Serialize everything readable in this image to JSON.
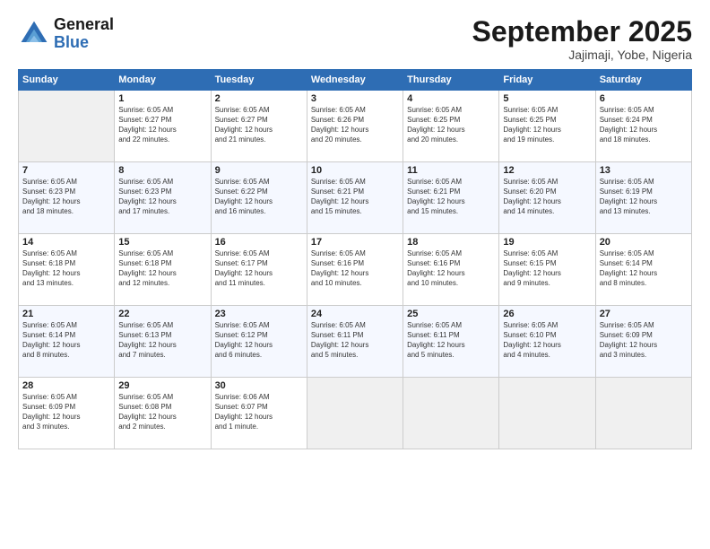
{
  "header": {
    "logo_general": "General",
    "logo_blue": "Blue",
    "month": "September 2025",
    "location": "Jajimaji, Yobe, Nigeria"
  },
  "days_of_week": [
    "Sunday",
    "Monday",
    "Tuesday",
    "Wednesday",
    "Thursday",
    "Friday",
    "Saturday"
  ],
  "weeks": [
    [
      {
        "day": "",
        "info": ""
      },
      {
        "day": "1",
        "info": "Sunrise: 6:05 AM\nSunset: 6:27 PM\nDaylight: 12 hours\nand 22 minutes."
      },
      {
        "day": "2",
        "info": "Sunrise: 6:05 AM\nSunset: 6:27 PM\nDaylight: 12 hours\nand 21 minutes."
      },
      {
        "day": "3",
        "info": "Sunrise: 6:05 AM\nSunset: 6:26 PM\nDaylight: 12 hours\nand 20 minutes."
      },
      {
        "day": "4",
        "info": "Sunrise: 6:05 AM\nSunset: 6:25 PM\nDaylight: 12 hours\nand 20 minutes."
      },
      {
        "day": "5",
        "info": "Sunrise: 6:05 AM\nSunset: 6:25 PM\nDaylight: 12 hours\nand 19 minutes."
      },
      {
        "day": "6",
        "info": "Sunrise: 6:05 AM\nSunset: 6:24 PM\nDaylight: 12 hours\nand 18 minutes."
      }
    ],
    [
      {
        "day": "7",
        "info": "Sunrise: 6:05 AM\nSunset: 6:23 PM\nDaylight: 12 hours\nand 18 minutes."
      },
      {
        "day": "8",
        "info": "Sunrise: 6:05 AM\nSunset: 6:23 PM\nDaylight: 12 hours\nand 17 minutes."
      },
      {
        "day": "9",
        "info": "Sunrise: 6:05 AM\nSunset: 6:22 PM\nDaylight: 12 hours\nand 16 minutes."
      },
      {
        "day": "10",
        "info": "Sunrise: 6:05 AM\nSunset: 6:21 PM\nDaylight: 12 hours\nand 15 minutes."
      },
      {
        "day": "11",
        "info": "Sunrise: 6:05 AM\nSunset: 6:21 PM\nDaylight: 12 hours\nand 15 minutes."
      },
      {
        "day": "12",
        "info": "Sunrise: 6:05 AM\nSunset: 6:20 PM\nDaylight: 12 hours\nand 14 minutes."
      },
      {
        "day": "13",
        "info": "Sunrise: 6:05 AM\nSunset: 6:19 PM\nDaylight: 12 hours\nand 13 minutes."
      }
    ],
    [
      {
        "day": "14",
        "info": "Sunrise: 6:05 AM\nSunset: 6:18 PM\nDaylight: 12 hours\nand 13 minutes."
      },
      {
        "day": "15",
        "info": "Sunrise: 6:05 AM\nSunset: 6:18 PM\nDaylight: 12 hours\nand 12 minutes."
      },
      {
        "day": "16",
        "info": "Sunrise: 6:05 AM\nSunset: 6:17 PM\nDaylight: 12 hours\nand 11 minutes."
      },
      {
        "day": "17",
        "info": "Sunrise: 6:05 AM\nSunset: 6:16 PM\nDaylight: 12 hours\nand 10 minutes."
      },
      {
        "day": "18",
        "info": "Sunrise: 6:05 AM\nSunset: 6:16 PM\nDaylight: 12 hours\nand 10 minutes."
      },
      {
        "day": "19",
        "info": "Sunrise: 6:05 AM\nSunset: 6:15 PM\nDaylight: 12 hours\nand 9 minutes."
      },
      {
        "day": "20",
        "info": "Sunrise: 6:05 AM\nSunset: 6:14 PM\nDaylight: 12 hours\nand 8 minutes."
      }
    ],
    [
      {
        "day": "21",
        "info": "Sunrise: 6:05 AM\nSunset: 6:14 PM\nDaylight: 12 hours\nand 8 minutes."
      },
      {
        "day": "22",
        "info": "Sunrise: 6:05 AM\nSunset: 6:13 PM\nDaylight: 12 hours\nand 7 minutes."
      },
      {
        "day": "23",
        "info": "Sunrise: 6:05 AM\nSunset: 6:12 PM\nDaylight: 12 hours\nand 6 minutes."
      },
      {
        "day": "24",
        "info": "Sunrise: 6:05 AM\nSunset: 6:11 PM\nDaylight: 12 hours\nand 5 minutes."
      },
      {
        "day": "25",
        "info": "Sunrise: 6:05 AM\nSunset: 6:11 PM\nDaylight: 12 hours\nand 5 minutes."
      },
      {
        "day": "26",
        "info": "Sunrise: 6:05 AM\nSunset: 6:10 PM\nDaylight: 12 hours\nand 4 minutes."
      },
      {
        "day": "27",
        "info": "Sunrise: 6:05 AM\nSunset: 6:09 PM\nDaylight: 12 hours\nand 3 minutes."
      }
    ],
    [
      {
        "day": "28",
        "info": "Sunrise: 6:05 AM\nSunset: 6:09 PM\nDaylight: 12 hours\nand 3 minutes."
      },
      {
        "day": "29",
        "info": "Sunrise: 6:05 AM\nSunset: 6:08 PM\nDaylight: 12 hours\nand 2 minutes."
      },
      {
        "day": "30",
        "info": "Sunrise: 6:06 AM\nSunset: 6:07 PM\nDaylight: 12 hours\nand 1 minute."
      },
      {
        "day": "",
        "info": ""
      },
      {
        "day": "",
        "info": ""
      },
      {
        "day": "",
        "info": ""
      },
      {
        "day": "",
        "info": ""
      }
    ]
  ]
}
